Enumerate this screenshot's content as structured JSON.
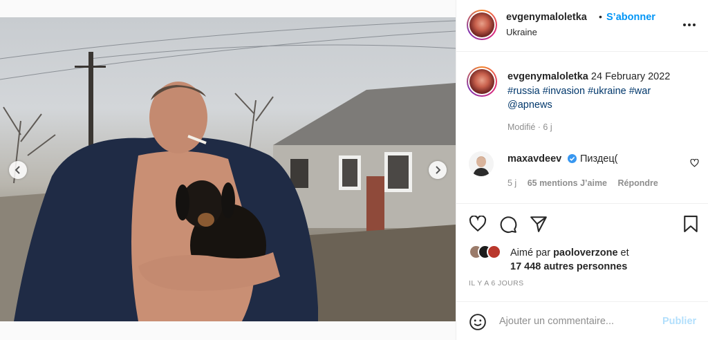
{
  "post": {
    "username": "evgenymaloletka",
    "follow_label": "S’abonner",
    "location": "Ukraine",
    "separator": "•"
  },
  "caption": {
    "username": "evgenymaloletka",
    "date": "24 February 2022",
    "tags": [
      "#russia",
      "#invasion",
      "#ukraine",
      "#war"
    ],
    "mention": "@apnews",
    "meta": "Modifié · 6 j"
  },
  "comment": {
    "username": "maxavdeev",
    "text": "Пиздец(",
    "age": "5 j",
    "likes": "65 mentions J’aime",
    "reply": "Répondre"
  },
  "likes": {
    "prefix": "Aimé par ",
    "user": "paoloverzone",
    "middle": " et",
    "count": "17 448 autres personnes"
  },
  "timestamp": "IL Y A 6 JOURS",
  "composer": {
    "placeholder": "Ajouter un commentaire...",
    "post_label": "Publier"
  },
  "carousel": {
    "slides": 8,
    "active_index": 1
  },
  "colors": {
    "accent": "#0095f6",
    "text": "#262626",
    "muted": "#8e8e8e",
    "hashtag": "#00376b",
    "post_disabled": "#b2dffc"
  },
  "icons": [
    "chevron-left-icon",
    "chevron-right-icon",
    "more-icon",
    "heart-icon",
    "comment-icon",
    "share-icon",
    "bookmark-icon",
    "emoji-icon",
    "verified-icon"
  ]
}
